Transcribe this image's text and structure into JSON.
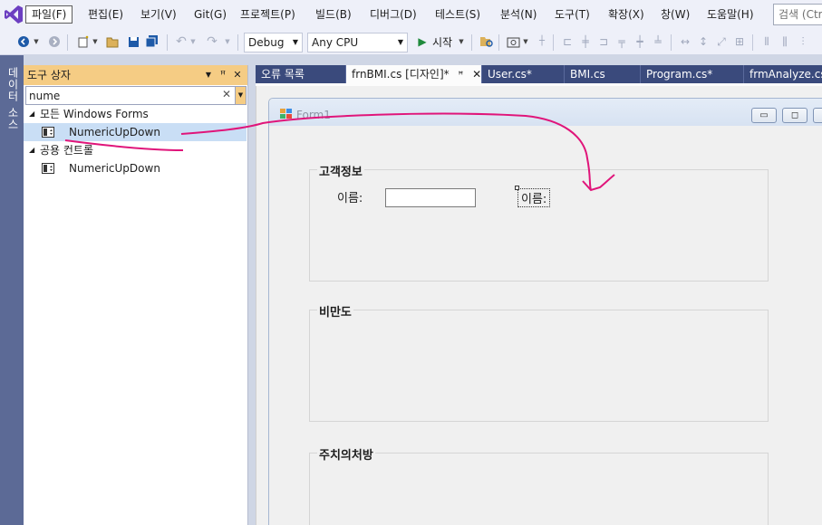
{
  "menubar": {
    "items": [
      "파일(F)",
      "편집(E)",
      "보기(V)",
      "Git(G)",
      "프로젝트(P)",
      "빌드(B)",
      "디버그(D)",
      "테스트(S)",
      "분석(N)",
      "도구(T)",
      "확장(X)",
      "창(W)",
      "도움말(H)"
    ],
    "search_text": "검색 (Ctrl"
  },
  "toolbar": {
    "config": "Debug",
    "platform": "Any CPU",
    "start_label": "시작"
  },
  "side_strip": {
    "label": "데이터 소스"
  },
  "toolbox": {
    "title": "도구 상자",
    "search_value": "nume",
    "groups": [
      {
        "label": "모든 Windows Forms",
        "items": [
          "NumericUpDown"
        ]
      },
      {
        "label": "공용 컨트롤",
        "items": [
          "NumericUpDown"
        ]
      }
    ]
  },
  "tabs": [
    {
      "label": "오류 목록"
    },
    {
      "label": "frnBMI.cs [디자인]*",
      "active": true
    },
    {
      "label": "User.cs*"
    },
    {
      "label": "BMI.cs"
    },
    {
      "label": "Program.cs*"
    },
    {
      "label": "frmAnalyze.cs"
    }
  ],
  "form": {
    "title": "Form1",
    "groups": [
      {
        "title": "고객정보",
        "name_label": "이름:",
        "name_label2": "이름:"
      },
      {
        "title": "비만도"
      },
      {
        "title": "주치의처방"
      }
    ]
  },
  "colors": {
    "accent": "#f5cc84",
    "tab_bar": "#3a4a7c",
    "annotation": "#e0157a"
  }
}
